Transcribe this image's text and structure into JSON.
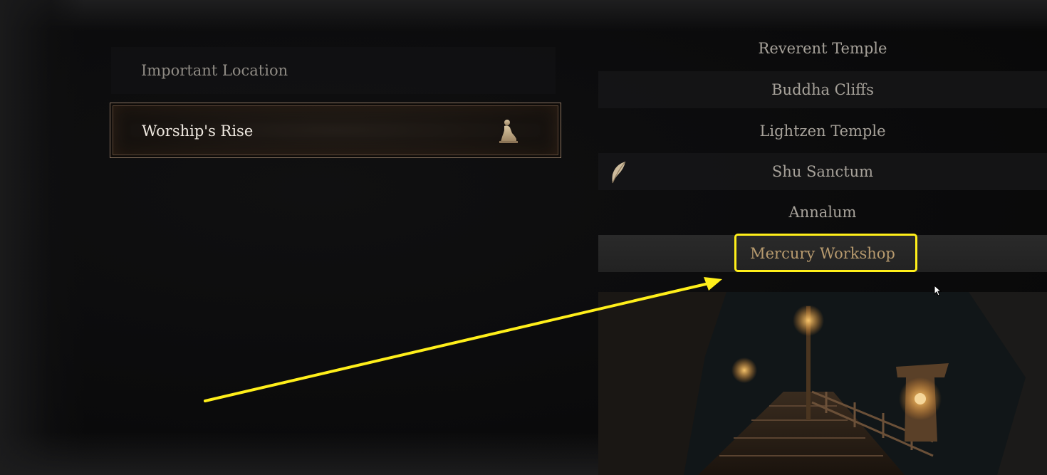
{
  "left_panel": {
    "category_header": "Important Location",
    "selected_location": {
      "name": "Worship's Rise",
      "icon": "kneeling-shrine-icon"
    }
  },
  "location_list": {
    "items": [
      {
        "label": "Reverent Temple"
      },
      {
        "label": "Buddha Cliffs"
      },
      {
        "label": "Lightzen Temple"
      },
      {
        "label": "Shu Sanctum",
        "icon": "feather-icon"
      },
      {
        "label": "Annalum"
      },
      {
        "label": "Mercury Workshop",
        "selected": true
      }
    ]
  },
  "colors": {
    "annotation": "#ffef1a",
    "selected_text": "#b79a6e",
    "frame_border": "#8a7461"
  }
}
